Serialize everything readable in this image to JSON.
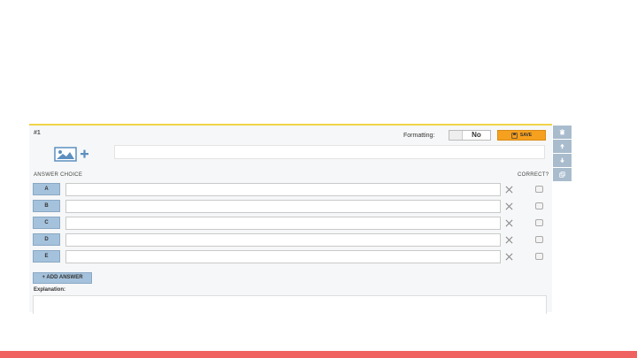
{
  "question": {
    "number": "#1",
    "formatting_label": "Formatting:",
    "formatting_value": "No",
    "save_label": "SAVE"
  },
  "answers": {
    "header_choice": "ANSWER CHOICE",
    "header_correct": "CORRECT?",
    "rows": [
      {
        "letter": "A",
        "value": "",
        "correct": false
      },
      {
        "letter": "B",
        "value": "",
        "correct": false
      },
      {
        "letter": "C",
        "value": "",
        "correct": false
      },
      {
        "letter": "D",
        "value": "",
        "correct": false
      },
      {
        "letter": "E",
        "value": "",
        "correct": false
      }
    ],
    "add_label": "+ ADD ANSWER"
  },
  "explanation": {
    "label": "Explanation:",
    "value": ""
  },
  "colors": {
    "accent_save": "#f5a01f",
    "letter_button": "#a5c2dc",
    "side_tool": "#a9bccd",
    "top_border": "#f0d34a",
    "bottom_bar": "#f0625f"
  },
  "icons": {
    "media": "image-add-icon",
    "save": "save-icon",
    "remove": "close-icon",
    "tools": [
      "trash-icon",
      "arrow-up-icon",
      "arrow-down-icon",
      "duplicate-icon"
    ]
  }
}
